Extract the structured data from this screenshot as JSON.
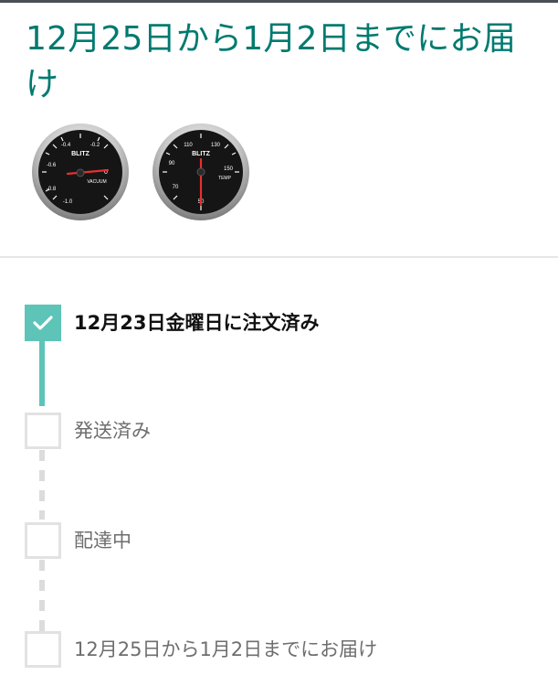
{
  "headline": "12月25日から1月2日までにお届け",
  "products": [
    {
      "name": "vacuum-gauge",
      "brand": "BLITZ",
      "dial_label": "VACUUM",
      "ticks": [
        "-1.0",
        "-0.8",
        "-0.6",
        "-0.4",
        "-0.2",
        "0"
      ]
    },
    {
      "name": "temp-gauge",
      "brand": "BLITZ",
      "dial_label": "TEMP",
      "ticks": [
        "50",
        "70",
        "90",
        "110",
        "130",
        "150"
      ]
    }
  ],
  "timeline": {
    "steps": [
      {
        "label": "12月23日金曜日に注文済み",
        "state": "done"
      },
      {
        "label": "発送済み",
        "state": "pending"
      },
      {
        "label": "配達中",
        "state": "pending"
      },
      {
        "label": "12月25日から1月2日までにお届け",
        "state": "pending"
      }
    ]
  },
  "colors": {
    "headline": "#007a70",
    "accent": "#5dc4b7",
    "unchecked_border": "#e2e2e2",
    "pending_text": "#6e6e6e"
  }
}
